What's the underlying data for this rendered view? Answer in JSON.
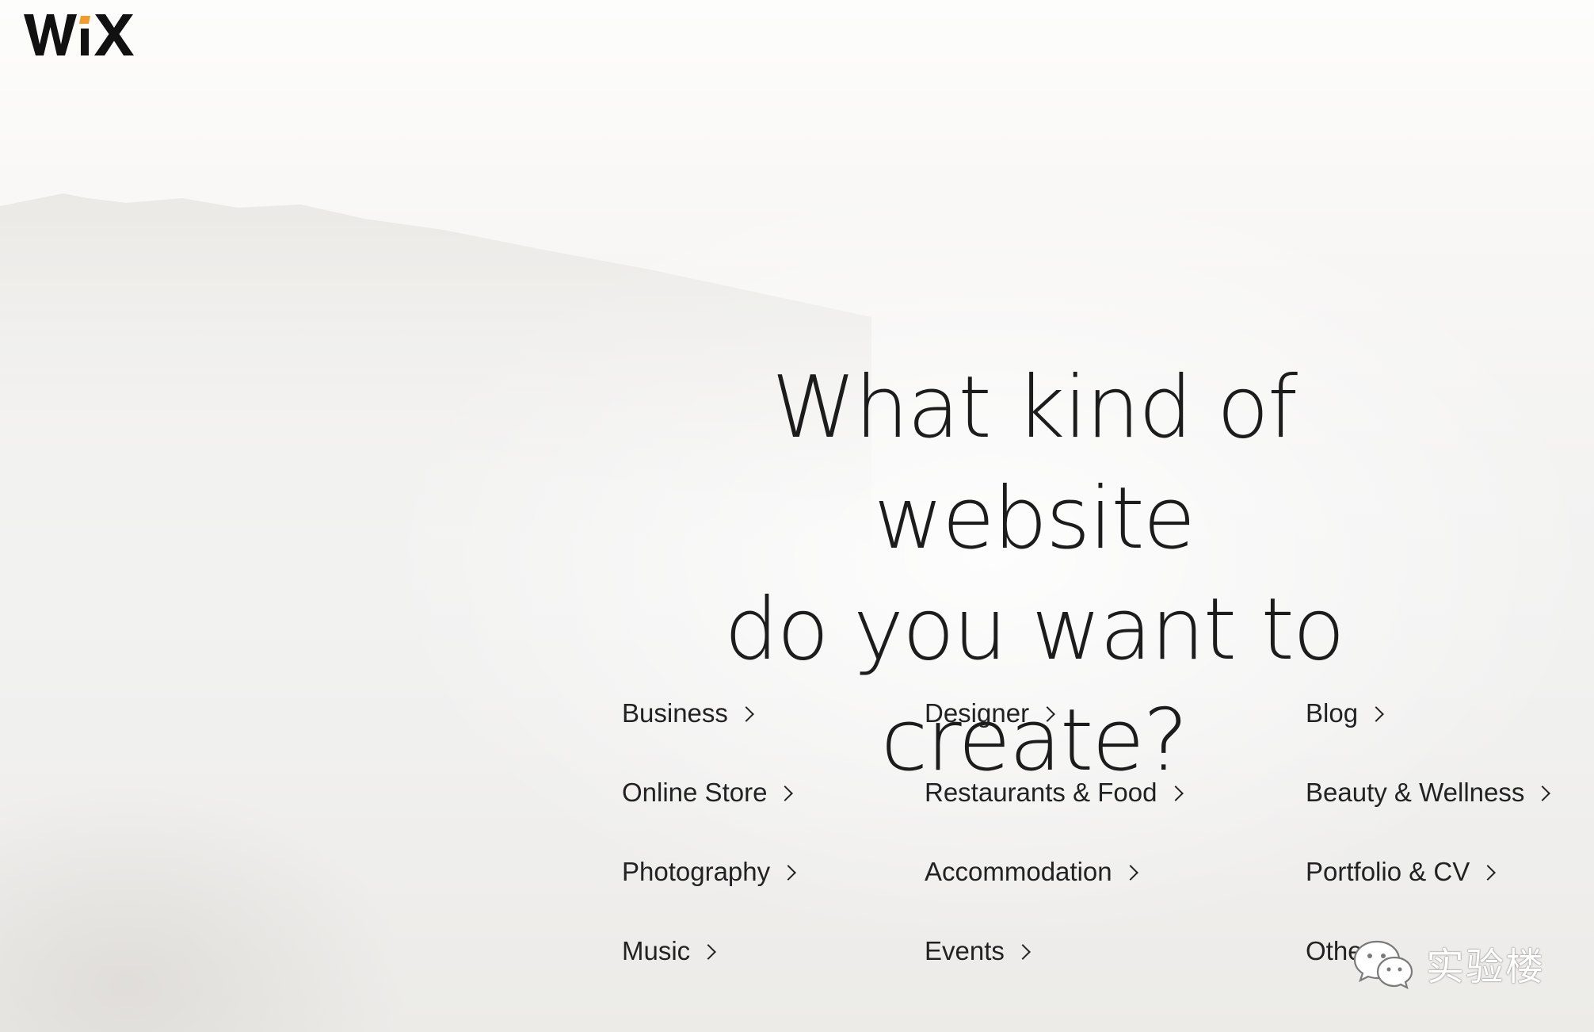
{
  "brand": {
    "logo_text": "WiX",
    "accent_color": "#f39c2b"
  },
  "headline": {
    "line1": "What kind of website",
    "line2": "do you want to create?"
  },
  "categories": {
    "col1": [
      "Business",
      "Online Store",
      "Photography",
      "Music"
    ],
    "col2": [
      "Designer",
      "Restaurants & Food",
      "Accommodation",
      "Events"
    ],
    "col3": [
      "Blog",
      "Beauty & Wellness",
      "Portfolio & CV",
      "Other"
    ]
  },
  "watermark": {
    "text": "实验楼",
    "icon": "wechat-icon"
  }
}
